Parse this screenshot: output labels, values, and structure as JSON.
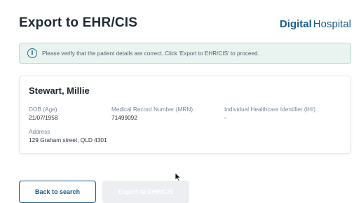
{
  "header": {
    "title": "Export to EHR/CIS",
    "brand_bold": "Digital",
    "brand_regular": "Hospital"
  },
  "info_banner": {
    "icon": "info-icon",
    "message": "Please verify that the patient details are correct. Click 'Export to EHR/CIS' to proceed."
  },
  "patient": {
    "name": "Stewart, Millie",
    "dob_label": "DOB (Age)",
    "dob_value": "21/07/1958",
    "mrn_label": "Medical Record Number (MRN)",
    "mrn_value": "71499092",
    "ihi_label": "Individual Healthcare Identifier (IHI)",
    "ihi_value": "-",
    "address_label": "Address",
    "address_value": "129 Graham street, QLD 4301"
  },
  "actions": {
    "back_label": "Back to search",
    "export_label": "Export to EHR/CIS"
  },
  "colors": {
    "brand": "#1a5b8a",
    "banner_bg": "#e9f4f1",
    "banner_border": "#b9ddd4",
    "disabled_button": "#eceef1"
  }
}
